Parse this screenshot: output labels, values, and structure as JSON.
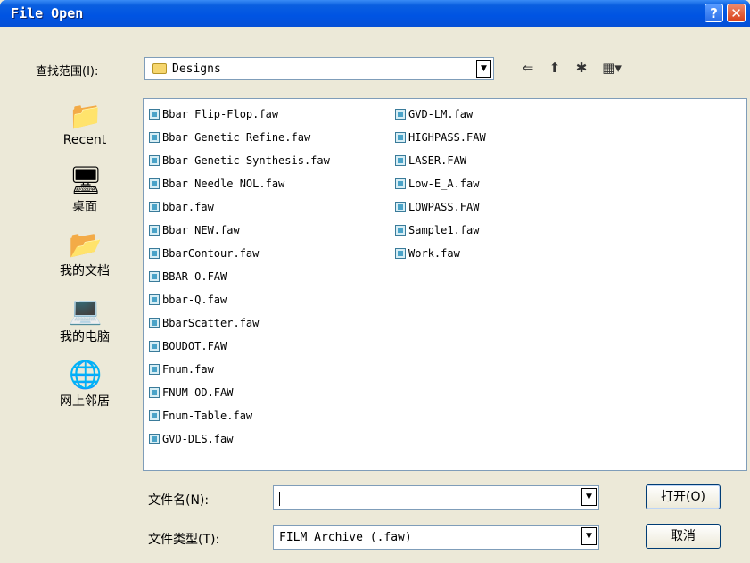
{
  "window": {
    "title": "File Open"
  },
  "lookin": {
    "label": "查找范围(I):",
    "value": "Designs"
  },
  "places": [
    {
      "label": "Recent",
      "icon": "recent-folder-icon"
    },
    {
      "label": "桌面",
      "icon": "desktop-icon"
    },
    {
      "label": "我的文档",
      "icon": "my-documents-icon"
    },
    {
      "label": "我的电脑",
      "icon": "my-computer-icon"
    },
    {
      "label": "网上邻居",
      "icon": "network-places-icon"
    }
  ],
  "files": {
    "col1": [
      "Bbar Flip-Flop.faw",
      "Bbar Genetic Refine.faw",
      "Bbar Genetic Synthesis.faw",
      "Bbar Needle NOL.faw",
      "bbar.faw",
      "Bbar_NEW.faw",
      "BbarContour.faw",
      "BBAR-O.FAW",
      "bbar-Q.faw",
      "BbarScatter.faw",
      "BOUDOT.FAW",
      "Fnum.faw",
      "FNUM-OD.FAW",
      "Fnum-Table.faw",
      "GVD-DLS.faw"
    ],
    "col2": [
      "GVD-LM.faw",
      "HIGHPASS.FAW",
      "LASER.FAW",
      "Low-E_A.faw",
      "LOWPASS.FAW",
      "Sample1.faw",
      "Work.faw"
    ]
  },
  "filename": {
    "label": "文件名(N):",
    "value": ""
  },
  "filetype": {
    "label": "文件类型(T):",
    "value": "FILM Archive (.faw)"
  },
  "buttons": {
    "open": "打开(O)",
    "cancel": "取消"
  }
}
